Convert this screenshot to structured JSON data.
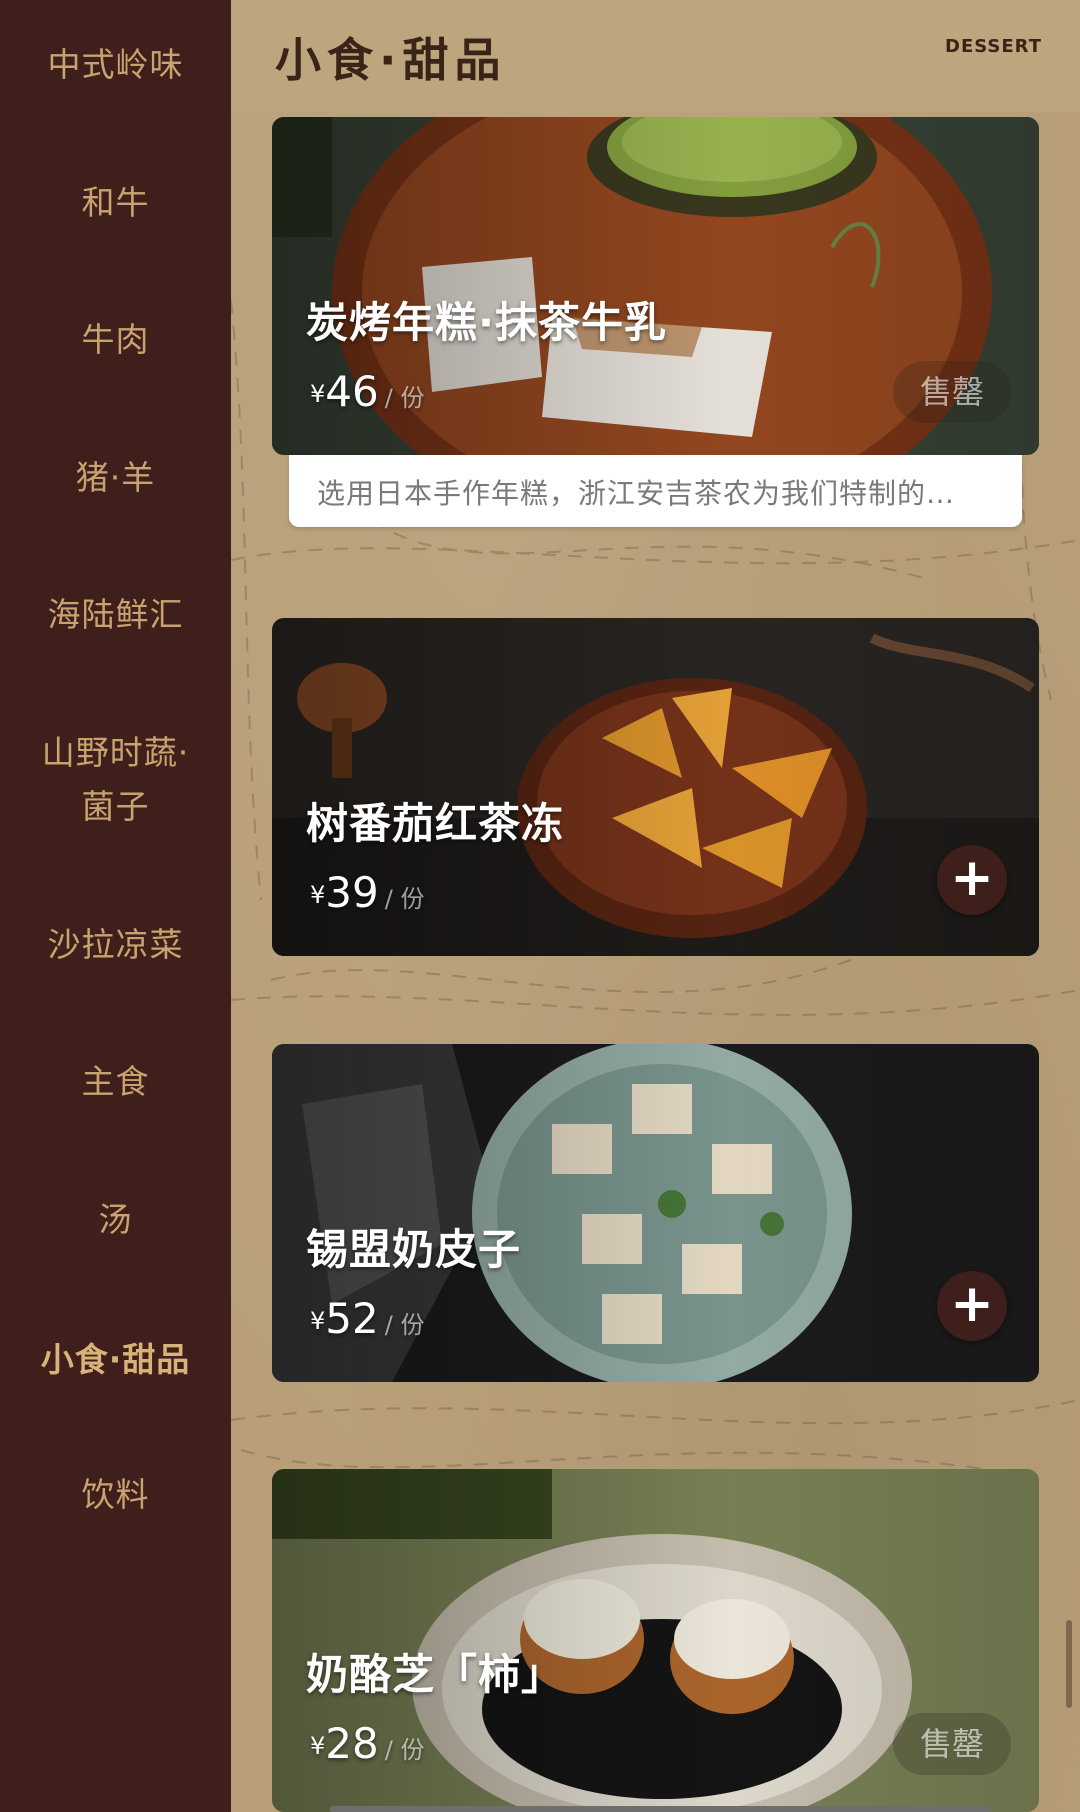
{
  "sidebar": {
    "items": [
      {
        "label": "中式岭味"
      },
      {
        "label": "和牛"
      },
      {
        "label": "牛肉"
      },
      {
        "label": "猪·羊"
      },
      {
        "label": "海陆鲜汇"
      },
      {
        "label": "山野时蔬·",
        "label2": "菌子"
      },
      {
        "label": "沙拉凉菜"
      },
      {
        "label": "主食"
      },
      {
        "label": "汤"
      },
      {
        "label": "小食·甜品",
        "active": true
      },
      {
        "label": "饮料"
      }
    ]
  },
  "header": {
    "title": "小食·甜品",
    "subtitle": "DESSERT"
  },
  "dishes": [
    {
      "name": "炭烤年糕·抹茶牛乳",
      "currency": "¥",
      "price": "46",
      "unit": "/ 份",
      "status": "售罄",
      "description": "选用日本手作年糕，浙江安吉茶农为我们特制的…"
    },
    {
      "name": "树番茄红茶冻",
      "currency": "¥",
      "price": "39",
      "unit": "/ 份",
      "add": "+"
    },
    {
      "name": "锡盟奶皮子",
      "currency": "¥",
      "price": "52",
      "unit": "/ 份",
      "add": "+"
    },
    {
      "name": "奶酪芝「柿」",
      "currency": "¥",
      "price": "28",
      "unit": "/ 份",
      "status": "售罄"
    }
  ],
  "colors": {
    "sidebar_bg": "#3e1f1b",
    "sidebar_text": "#c9a36f",
    "page_bg": "#b89f78",
    "add_button": "#3e1f1b"
  }
}
